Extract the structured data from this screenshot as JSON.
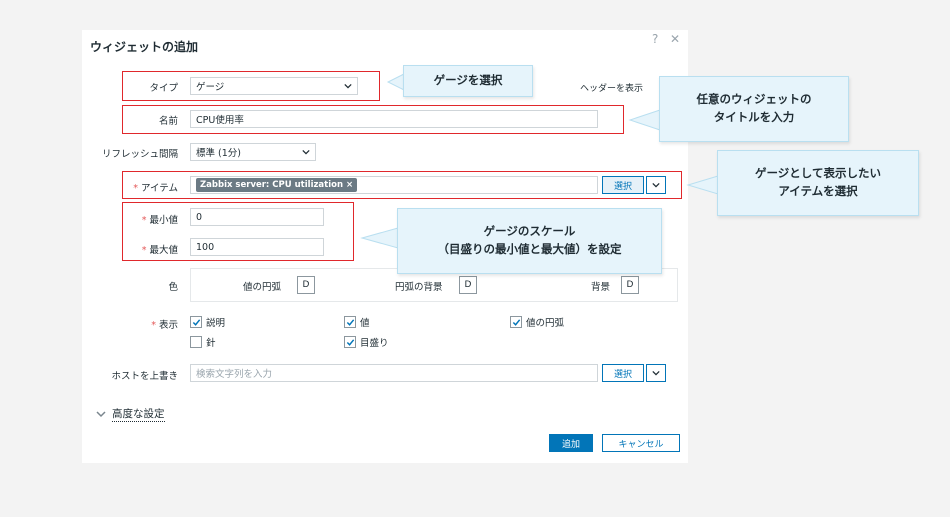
{
  "dialog": {
    "title": "ウィジェットの追加",
    "help_icon": "?",
    "close_icon": "✕"
  },
  "form": {
    "type_label": "タイプ",
    "type_value": "ゲージ",
    "show_header_label": "ヘッダーを表示",
    "name_label": "名前",
    "name_value": "CPU使用率",
    "refresh_label": "リフレッシュ間隔",
    "refresh_value": "標準 (1分)",
    "item_label": "アイテム",
    "item_required": "*",
    "item_tag": "Zabbix server: CPU utilization",
    "item_tag_remove": "×",
    "select_button": "選択",
    "min_label": "最小値",
    "min_required": "*",
    "min_value": "0",
    "max_label": "最大値",
    "max_required": "*",
    "max_value": "100",
    "color_label": "色",
    "color_items": [
      {
        "label": "値の円弧",
        "swatch": "D"
      },
      {
        "label": "円弧の背景",
        "swatch": "D"
      },
      {
        "label": "背景",
        "swatch": "D"
      }
    ],
    "show_label": "表示",
    "show_required": "*",
    "show_options": [
      {
        "label": "説明",
        "checked": true
      },
      {
        "label": "値",
        "checked": true
      },
      {
        "label": "値の円弧",
        "checked": true
      },
      {
        "label": "針",
        "checked": false
      },
      {
        "label": "目盛り",
        "checked": true
      }
    ],
    "host_override_label": "ホストを上書き",
    "host_override_placeholder": "検索文字列を入力",
    "host_select_button": "選択",
    "advanced_label": "高度な設定"
  },
  "footer": {
    "add_button": "追加",
    "cancel_button": "キャンセル"
  },
  "callouts": {
    "type": "ゲージを選択",
    "title_line1": "任意のウィジェットの",
    "title_line2": "タイトルを入力",
    "item_line1": "ゲージとして表示したい",
    "item_line2": "アイテムを選択",
    "scale_line1": "ゲージのスケール",
    "scale_line2": "（目盛りの最小値と最大値）を設定"
  },
  "colors": {
    "accent": "#0275b8",
    "highlight": "#e0282c",
    "callout_bg": "#e6f4fb"
  }
}
